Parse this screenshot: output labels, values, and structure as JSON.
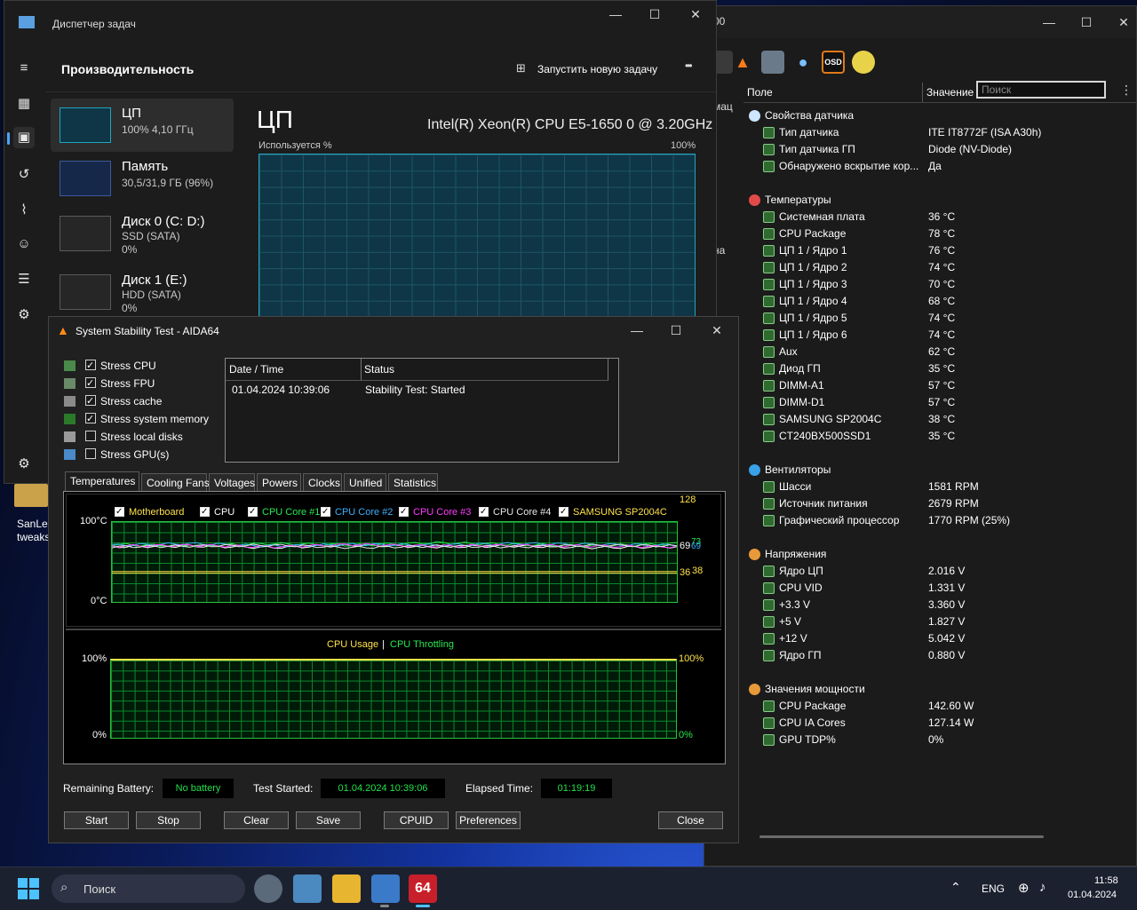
{
  "desktop": {
    "icon_label": "SanLex tweaks"
  },
  "task_manager": {
    "title": "Диспетчер задач",
    "section": "Производительность",
    "new_task": "Запустить новую задачу",
    "more": "•••",
    "items": [
      {
        "name": "ЦП",
        "l2": "100%  4,10 ГГц"
      },
      {
        "name": "Память",
        "l2": "30,5/31,9 ГБ (96%)"
      },
      {
        "name": "Диск 0 (C: D:)",
        "l2": "SSD (SATA)",
        "l3": "0%"
      },
      {
        "name": "Диск 1 (E:)",
        "l2": "HDD (SATA)",
        "l3": "0%"
      }
    ],
    "cpu_big": "ЦП",
    "cpu_model": "Intel(R) Xeon(R) CPU E5-1650 0 @ 3.20GHz",
    "usage_label": "Используется %",
    "usage_max": "100%"
  },
  "sensors": {
    "title_fragment": "00",
    "search_placeholder": "Поиск",
    "osd_label": "OSD",
    "col_field": "Поле",
    "col_value": "Значение",
    "side_text_1": "мац",
    "side_text_2": "на",
    "groups": [
      {
        "title": "Свойства датчика",
        "rows": [
          {
            "f": "Тип датчика",
            "v": "ITE IT8772F  (ISA A30h)"
          },
          {
            "f": "Тип датчика ГП",
            "v": "Diode  (NV-Diode)"
          },
          {
            "f": "Обнаружено вскрытие кор...",
            "v": "Да"
          }
        ]
      },
      {
        "title": "Температуры",
        "rows": [
          {
            "f": "Системная плата",
            "v": "36 °C"
          },
          {
            "f": "CPU Package",
            "v": "78 °C"
          },
          {
            "f": "ЦП 1 / Ядро 1",
            "v": "76 °C"
          },
          {
            "f": "ЦП 1 / Ядро 2",
            "v": "74 °C"
          },
          {
            "f": "ЦП 1 / Ядро 3",
            "v": "70 °C"
          },
          {
            "f": "ЦП 1 / Ядро 4",
            "v": "68 °C"
          },
          {
            "f": "ЦП 1 / Ядро 5",
            "v": "74 °C"
          },
          {
            "f": "ЦП 1 / Ядро 6",
            "v": "74 °C"
          },
          {
            "f": "Aux",
            "v": "62 °C"
          },
          {
            "f": "Диод ГП",
            "v": "35 °C"
          },
          {
            "f": "DIMM-A1",
            "v": "57 °C"
          },
          {
            "f": "DIMM-D1",
            "v": "57 °C"
          },
          {
            "f": "SAMSUNG SP2004C",
            "v": "38 °C"
          },
          {
            "f": "CT240BX500SSD1",
            "v": "35 °C"
          }
        ]
      },
      {
        "title": "Вентиляторы",
        "rows": [
          {
            "f": "Шасси",
            "v": "1581 RPM"
          },
          {
            "f": "Источник питания",
            "v": "2679 RPM"
          },
          {
            "f": "Графический процессор",
            "v": "1770 RPM  (25%)"
          }
        ]
      },
      {
        "title": "Напряжения",
        "rows": [
          {
            "f": "Ядро ЦП",
            "v": "2.016 V"
          },
          {
            "f": "CPU VID",
            "v": "1.331 V"
          },
          {
            "f": "+3.3 V",
            "v": "3.360 V"
          },
          {
            "f": "+5 V",
            "v": "1.827 V"
          },
          {
            "f": "+12 V",
            "v": "5.042 V"
          },
          {
            "f": "Ядро ГП",
            "v": "0.880 V"
          }
        ]
      },
      {
        "title": "Значения мощности",
        "rows": [
          {
            "f": "CPU Package",
            "v": "142.60 W"
          },
          {
            "f": "CPU IA Cores",
            "v": "127.14 W"
          },
          {
            "f": "GPU TDP%",
            "v": "0%"
          }
        ]
      }
    ]
  },
  "aida": {
    "title": "System Stability Test - AIDA64",
    "stress": [
      {
        "label": "Stress CPU",
        "checked": true
      },
      {
        "label": "Stress FPU",
        "checked": true
      },
      {
        "label": "Stress cache",
        "checked": true
      },
      {
        "label": "Stress system memory",
        "checked": true
      },
      {
        "label": "Stress local disks",
        "checked": false
      },
      {
        "label": "Stress GPU(s)",
        "checked": false
      }
    ],
    "log_col_date": "Date / Time",
    "log_col_status": "Status",
    "log_date": "01.04.2024 10:39:06",
    "log_status": "Stability Test: Started",
    "tabs": [
      "Temperatures",
      "Cooling Fans",
      "Voltages",
      "Powers",
      "Clocks",
      "Unified",
      "Statistics"
    ],
    "temp_legend": [
      {
        "name": "Motherboard",
        "color": "#ffe24a"
      },
      {
        "name": "CPU",
        "color": "#ffffff"
      },
      {
        "name": "CPU Core #1",
        "color": "#27e84f"
      },
      {
        "name": "CPU Core #2",
        "color": "#3ab0ff"
      },
      {
        "name": "CPU Core #3",
        "color": "#ff3bff"
      },
      {
        "name": "CPU Core #4",
        "color": "#e6e6e6"
      },
      {
        "name": "SAMSUNG SP2004C",
        "color": "#ffe24a"
      }
    ],
    "temp_y_top": "100°C",
    "temp_y_bot": "0°C",
    "temp_r_top": "128",
    "temp_r_69": "69",
    "temp_r_73": "73",
    "temp_r_69b": "69",
    "temp_r_36": "36",
    "temp_r_38": "38",
    "usage_title": "CPU Usage",
    "usage_sep": "|",
    "throttle_title": "CPU Throttling",
    "usage_l_top": "100%",
    "usage_l_bot": "0%",
    "usage_r_top": "100%",
    "usage_r_bot": "0%",
    "remaining_battery_label": "Remaining Battery:",
    "remaining_battery": "No battery",
    "test_started_label": "Test Started:",
    "test_started": "01.04.2024 10:39:06",
    "elapsed_label": "Elapsed Time:",
    "elapsed": "01:19:19",
    "buttons": {
      "start": "Start",
      "stop": "Stop",
      "clear": "Clear",
      "save": "Save",
      "cpuid": "CPUID",
      "prefs": "Preferences",
      "close": "Close"
    }
  },
  "chart_data": {
    "type": "line",
    "title": "",
    "xlabel": "",
    "ylabel": "",
    "ylim": [
      0,
      100
    ],
    "series": [
      {
        "name": "Motherboard",
        "values": [
          36,
          36,
          36,
          36,
          36,
          36,
          36,
          36
        ]
      },
      {
        "name": "CPU",
        "values": [
          69,
          70,
          68,
          71,
          69,
          70,
          68,
          69
        ]
      },
      {
        "name": "CPU Core #1",
        "values": [
          72,
          70,
          73,
          71,
          74,
          72,
          70,
          73
        ]
      },
      {
        "name": "CPU Core #2",
        "values": [
          71,
          73,
          70,
          72,
          71,
          73,
          72,
          71
        ]
      },
      {
        "name": "CPU Core #3",
        "values": [
          70,
          71,
          69,
          72,
          70,
          71,
          70,
          69
        ]
      },
      {
        "name": "CPU Core #4",
        "values": [
          69,
          70,
          71,
          68,
          70,
          69,
          71,
          70
        ]
      },
      {
        "name": "SAMSUNG SP2004C",
        "values": [
          38,
          38,
          38,
          38,
          38,
          38,
          38,
          38
        ]
      }
    ]
  },
  "taskbar": {
    "search": "Поиск",
    "lang": "ENG",
    "time": "11:58",
    "date": "01.04.2024",
    "aida_badge": "64"
  }
}
